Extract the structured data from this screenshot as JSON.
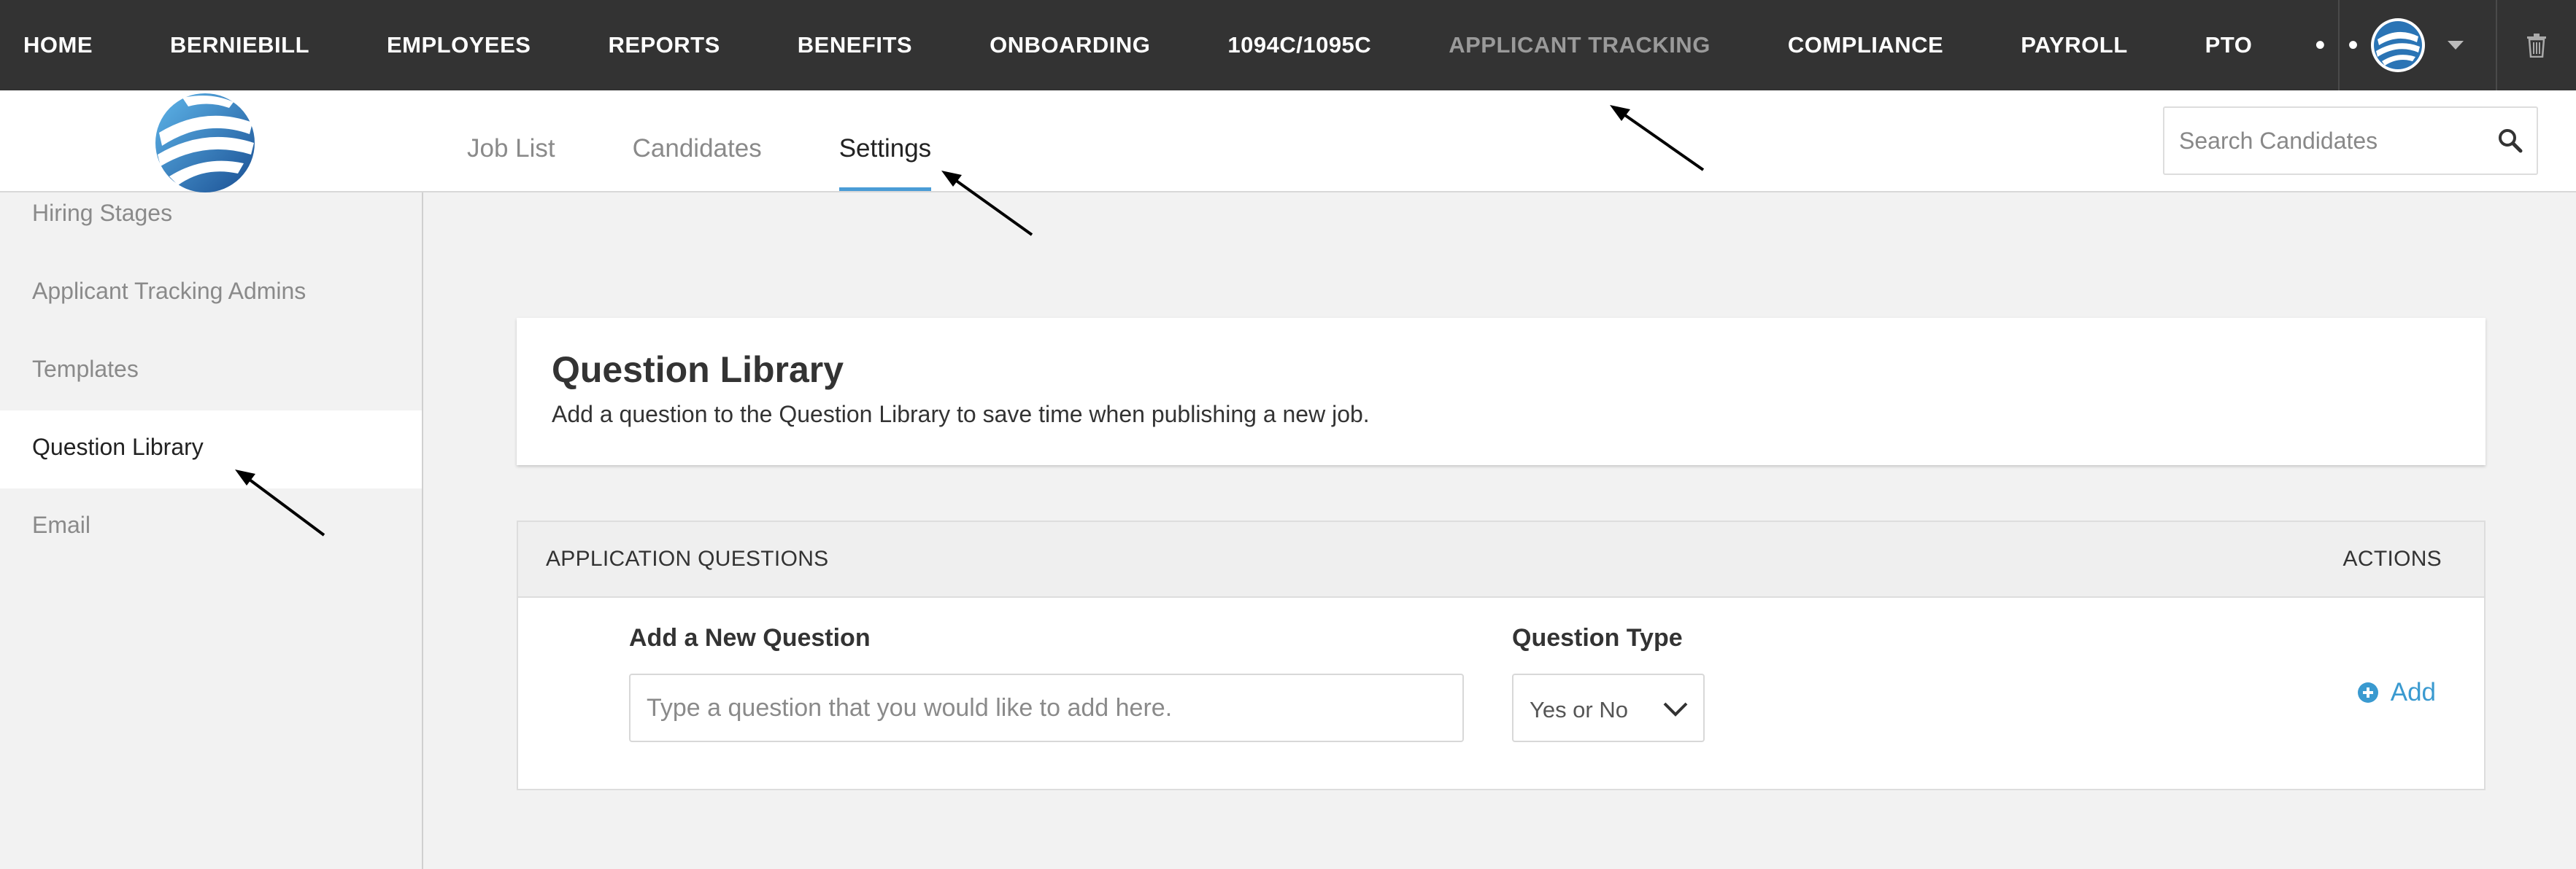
{
  "top_nav": {
    "items": [
      "HOME",
      "BERNIEBILL",
      "EMPLOYEES",
      "REPORTS",
      "BENEFITS",
      "ONBOARDING",
      "1094C/1095C",
      "APPLICANT TRACKING",
      "COMPLIANCE",
      "PAYROLL",
      "PTO"
    ],
    "active_item": "APPLICANT TRACKING",
    "more_label": "• • •"
  },
  "subnav": {
    "tabs": [
      "Job List",
      "Candidates",
      "Settings"
    ],
    "active_tab": "Settings",
    "search_placeholder": "Search Candidates"
  },
  "sidebar": {
    "items": [
      "Hiring Stages",
      "Applicant Tracking Admins",
      "Templates",
      "Question Library",
      "Email"
    ],
    "active_item": "Question Library"
  },
  "page": {
    "title": "Question Library",
    "description": "Add a question to the Question Library to save time when publishing a new job."
  },
  "questions_table": {
    "header_questions": "APPLICATION QUESTIONS",
    "header_actions": "ACTIONS",
    "new_question_label": "Add a New Question",
    "new_question_placeholder": "Type a question that you would like to add here.",
    "type_label": "Question Type",
    "type_value": "Yes or No",
    "add_label": "Add"
  },
  "colors": {
    "nav_bg": "#333333",
    "accent_blue": "#4a9cd6",
    "add_link": "#3a9ad0",
    "muted_nav": "#9a9a9a"
  }
}
